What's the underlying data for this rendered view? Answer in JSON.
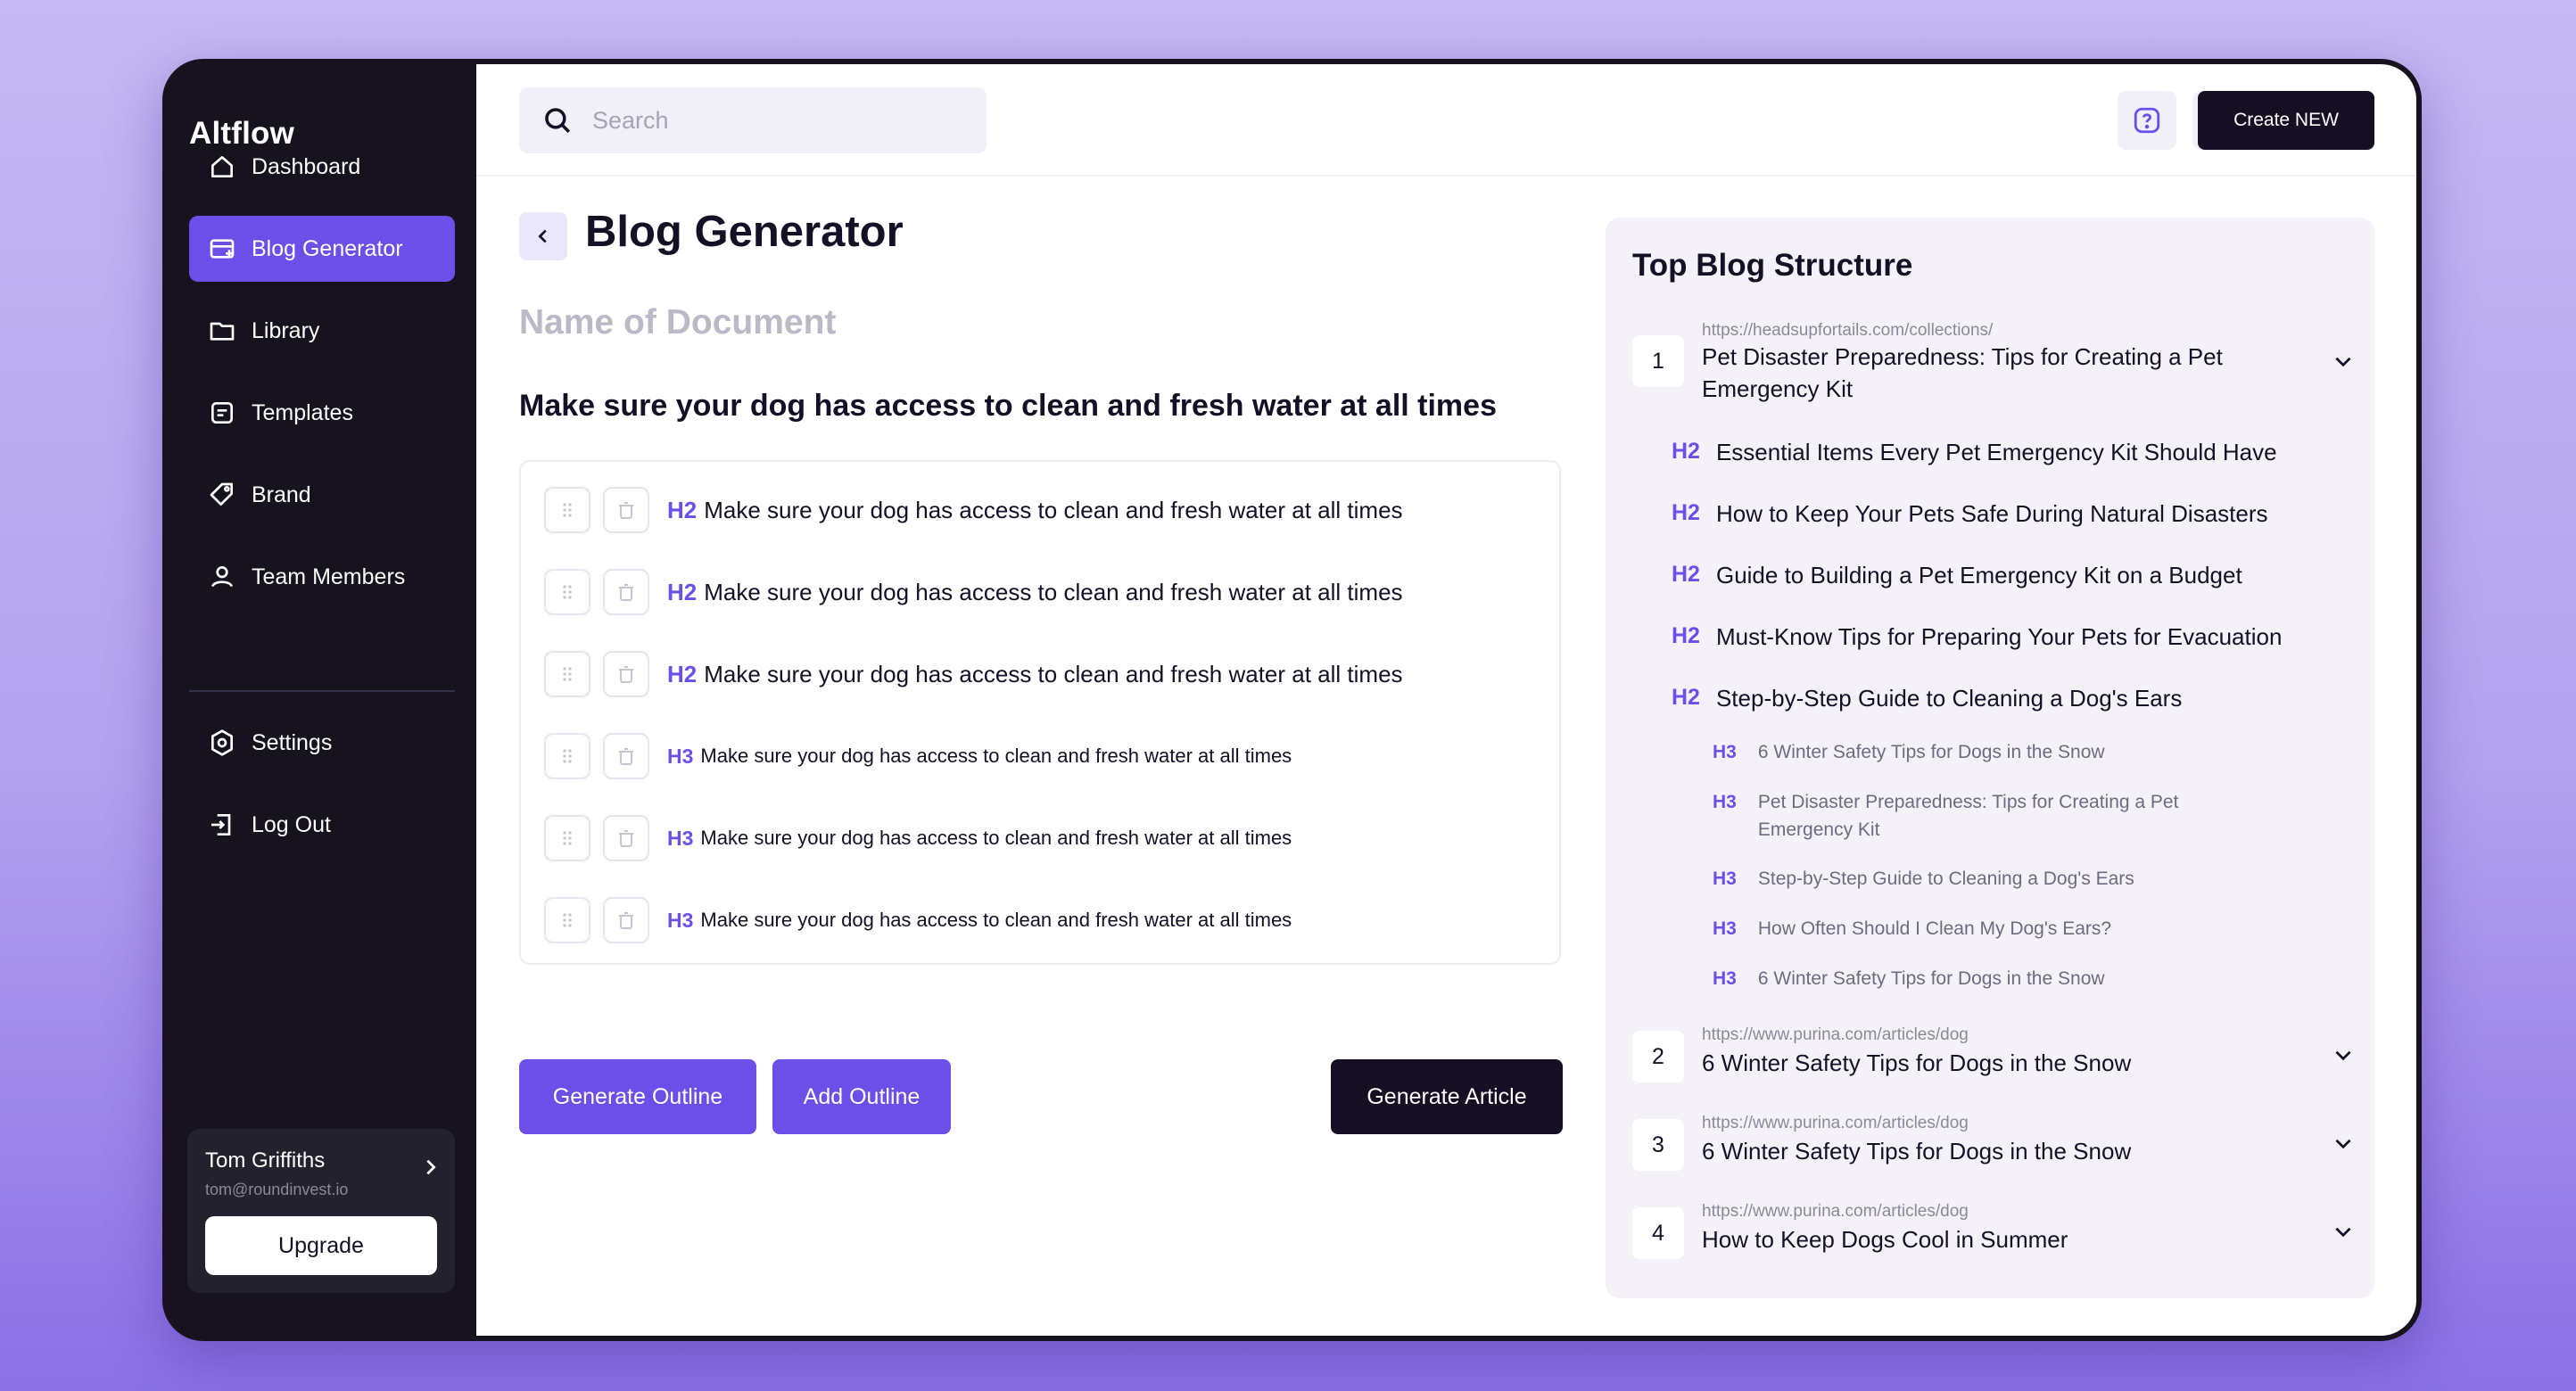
{
  "app": {
    "logo": "Altflow"
  },
  "sidebar": {
    "items": [
      {
        "label": "Dashboard",
        "icon": "home-icon",
        "active": false
      },
      {
        "label": "Blog Generator",
        "icon": "blog-generator-icon",
        "active": true
      },
      {
        "label": "Library",
        "icon": "folder-icon",
        "active": false
      },
      {
        "label": "Templates",
        "icon": "templates-icon",
        "active": false
      },
      {
        "label": "Brand",
        "icon": "tag-icon",
        "active": false
      },
      {
        "label": "Team Members",
        "icon": "user-icon",
        "active": false
      },
      {
        "label": "Settings",
        "icon": "gear-icon",
        "active": false
      },
      {
        "label": "Log Out",
        "icon": "logout-icon",
        "active": false
      }
    ],
    "user": {
      "name": "Tom Griffiths",
      "email": "tom@roundinvest.io",
      "upgrade_label": "Upgrade"
    }
  },
  "topbar": {
    "search_placeholder": "Search",
    "icons": [
      "help-icon",
      "support-icon",
      "bell-icon"
    ],
    "create_label": "Create NEW"
  },
  "main": {
    "title": "Blog Generator",
    "doc_name_placeholder": "Name of Document",
    "heading": "Make sure your dog has access to clean and fresh water at all times",
    "outline": [
      {
        "level": "H2",
        "text": "Make sure your dog has access to clean and fresh water at all times"
      },
      {
        "level": "H2",
        "text": "Make sure your dog has access to clean and fresh water at all times"
      },
      {
        "level": "H2",
        "text": "Make sure your dog has access to clean and fresh water at all times"
      },
      {
        "level": "H3",
        "text": "Make sure your dog has access to clean and fresh water at all times"
      },
      {
        "level": "H3",
        "text": "Make sure your dog has access to clean and fresh water at all times"
      },
      {
        "level": "H3",
        "text": "Make sure your dog has access to clean and fresh water at all times"
      }
    ],
    "buttons": {
      "generate_outline": "Generate Outline",
      "add_outline": "Add Outline",
      "generate_article": "Generate Article"
    }
  },
  "panel": {
    "title": "Top Blog Structure",
    "sources": [
      {
        "num": "1",
        "url": "https://headsupfortails.com/collections/",
        "title": "Pet Disaster Preparedness: Tips for Creating a Pet Emergency Kit",
        "expanded": true,
        "headings": [
          {
            "level": "H2",
            "text": "Essential Items Every Pet Emergency Kit Should Have"
          },
          {
            "level": "H2",
            "text": "How to Keep Your Pets Safe During Natural Disasters"
          },
          {
            "level": "H2",
            "text": "Guide to Building a Pet Emergency Kit on a Budget"
          },
          {
            "level": "H2",
            "text": "Must-Know Tips for Preparing Your Pets for Evacuation"
          },
          {
            "level": "H2",
            "text": "Step-by-Step Guide to Cleaning a Dog's Ears"
          },
          {
            "level": "H3",
            "text": "6 Winter Safety Tips for Dogs in the Snow"
          },
          {
            "level": "H3",
            "text": "Pet Disaster Preparedness: Tips for Creating a Pet Emergency Kit"
          },
          {
            "level": "H3",
            "text": "Step-by-Step Guide to Cleaning a Dog's Ears"
          },
          {
            "level": "H3",
            "text": "How Often Should I Clean My Dog's Ears?"
          },
          {
            "level": "H3",
            "text": "6 Winter Safety Tips for Dogs in the Snow"
          }
        ]
      },
      {
        "num": "2",
        "url": "https://www.purina.com/articles/dog",
        "title": "6 Winter Safety Tips for Dogs in the Snow",
        "expanded": false
      },
      {
        "num": "3",
        "url": "https://www.purina.com/articles/dog",
        "title": "6 Winter Safety Tips for Dogs in the Snow",
        "expanded": false
      },
      {
        "num": "4",
        "url": "https://www.purina.com/articles/dog",
        "title": "How to Keep Dogs Cool in Summer",
        "expanded": false
      }
    ]
  },
  "colors": {
    "accent": "#6b4fe8",
    "dark": "#160f24",
    "sidebar_bg": "#16131f"
  }
}
